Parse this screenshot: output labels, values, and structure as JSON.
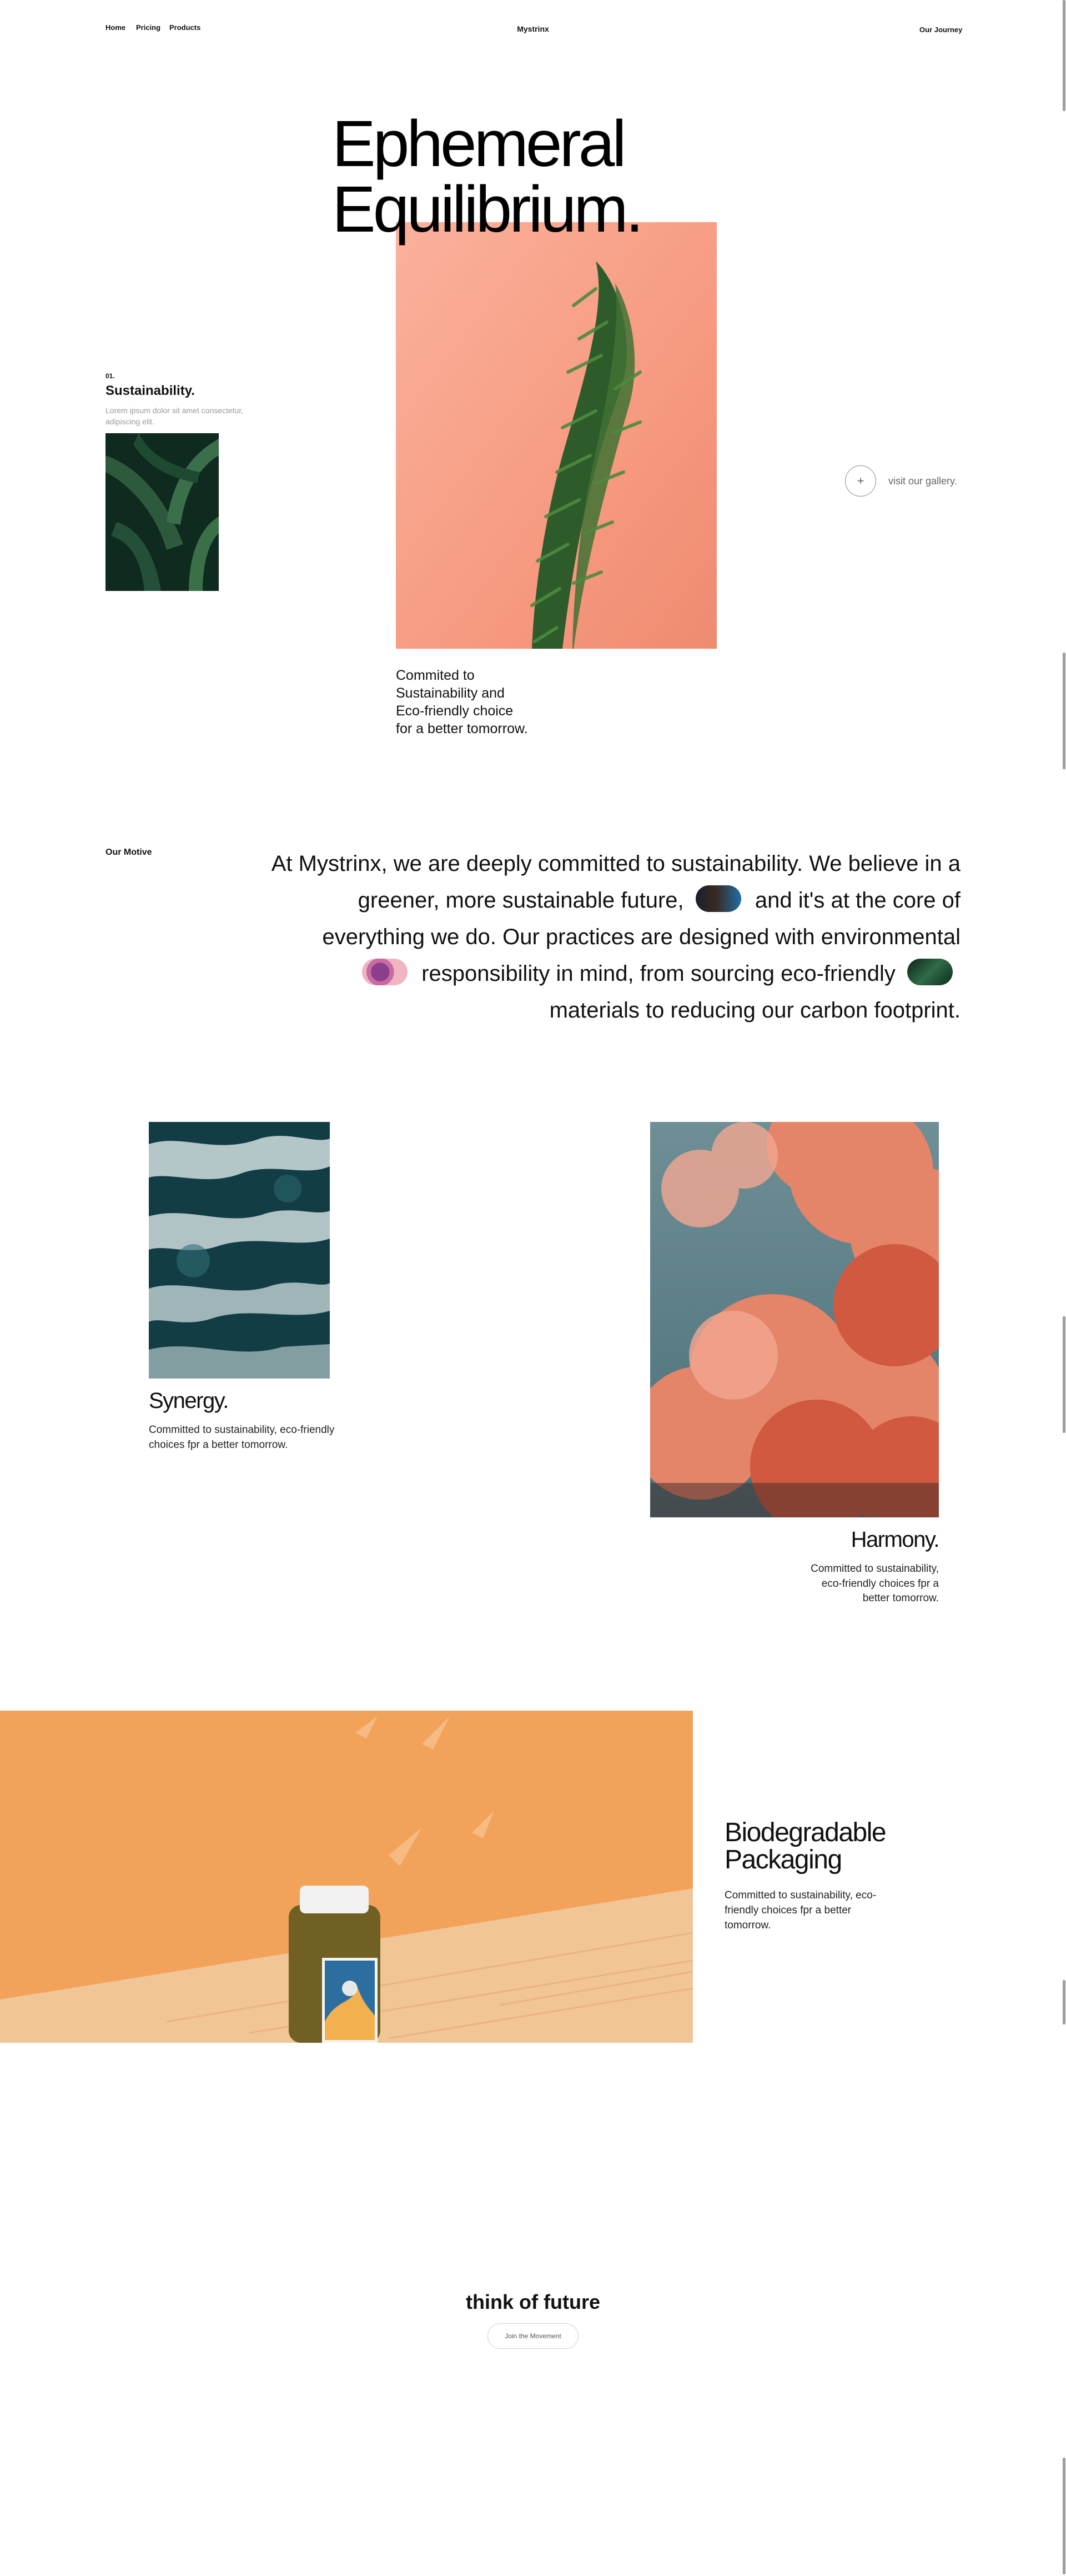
{
  "nav": {
    "links": [
      "Home",
      "Pricing",
      "Products"
    ],
    "brand": "Mystrinx",
    "journey": "Our Journey"
  },
  "hero": {
    "title_line1": "Ephemeral",
    "title_line2": "Equilibrium.",
    "caption": "Commited to Sustainability and Eco-friendly choice for a better tomorrow.",
    "side": {
      "number": "01.",
      "title": "Sustainability.",
      "description": "Lorem ipsum dolor sit amet consectetur, adipiscing elit."
    },
    "gallery_link": "visit our gallery."
  },
  "motive": {
    "label": "Our Motive",
    "part1": "At Mystrinx, we are deeply committed to sustainability. We believe in a greener, more sustainable future,",
    "part2": "and it's at the core of everything we do. Our practices are designed with environmental",
    "part3": "responsibility in mind, from sourcing eco-friendly",
    "part4": "materials to reducing our carbon footprint."
  },
  "cards": {
    "synergy": {
      "title": "Synergy.",
      "description": "Committed to sustainability, eco-friendly choices fpr a better tomorrow."
    },
    "harmony": {
      "title": "Harmony.",
      "description": "Committed to sustainability, eco-friendly choices fpr a better tomorrow."
    }
  },
  "packaging": {
    "title_line1": "Biodegradable",
    "title_line2": "Packaging",
    "description": "Committed to sustainability, eco-friendly choices fpr a better tomorrow."
  },
  "cta": {
    "title": "think of future",
    "button": "Join the Movement"
  },
  "colors": {
    "coral": "#f79b84",
    "deep_green": "#1b3a2d",
    "orange": "#f3a25a",
    "cloud": "#d46a50"
  }
}
